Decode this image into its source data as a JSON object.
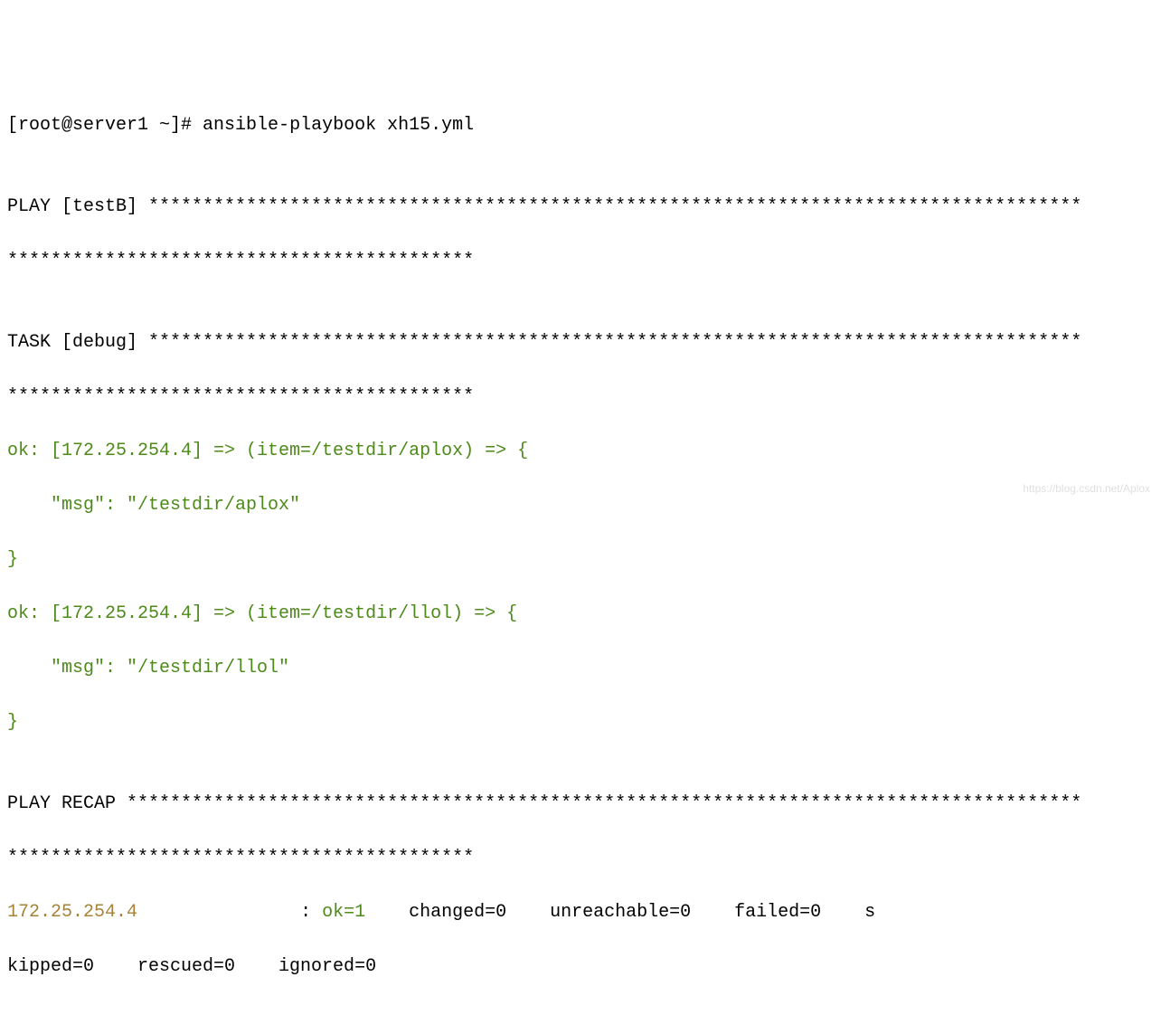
{
  "prompt": "[root@server1 ~]# ",
  "command": "ansible-playbook xh15.yml",
  "blank": "",
  "play_line1": "PLAY [testB] **************************************************************************************",
  "play_line2": "*******************************************",
  "task_line1": "TASK [debug] **************************************************************************************",
  "task_line2": "*******************************************",
  "ok_items": [
    {
      "header": "ok: [172.25.254.4] => (item=/testdir/aplox) => {",
      "msg": "    \"msg\": \"/testdir/aplox\"",
      "close": "}"
    },
    {
      "header": "ok: [172.25.254.4] => (item=/testdir/llol) => {",
      "msg": "    \"msg\": \"/testdir/llol\"",
      "close": "}"
    }
  ],
  "recap_line1": "PLAY RECAP ****************************************************************************************",
  "recap_line2": "*******************************************",
  "recap_host": "172.25.254.4               ",
  "recap_sep": ": ",
  "recap_ok": "ok=1   ",
  "recap_rest1": " changed=0    unreachable=0    failed=0    s",
  "recap_rest2": "kipped=0    rescued=0    ignored=0",
  "watermark": "https://blog.csdn.net/Aplox"
}
